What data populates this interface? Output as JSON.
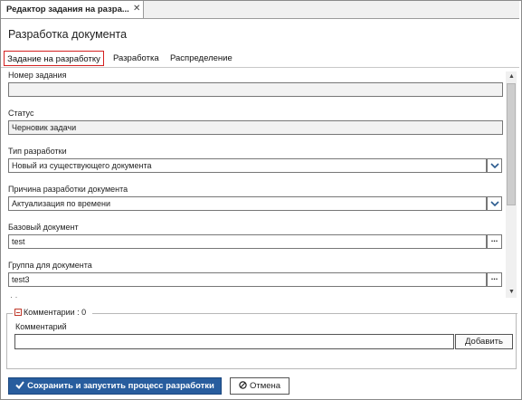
{
  "document_tab": {
    "title": "Редактор задания на разра...",
    "close_icon": "close-icon"
  },
  "page_title": "Разработка документа",
  "subtabs": [
    {
      "label": "Задание на разработку",
      "active": true
    },
    {
      "label": "Разработка",
      "active": false
    },
    {
      "label": "Распределение",
      "active": false
    }
  ],
  "fields": {
    "task_number": {
      "label": "Номер задания",
      "value": ""
    },
    "status": {
      "label": "Статус",
      "value": "Черновик задачи"
    },
    "dev_type": {
      "label": "Тип разработки",
      "value": "Новый из существующего документа"
    },
    "reason": {
      "label": "Причина разработки документа",
      "value": "Актуализация по времени"
    },
    "base_doc": {
      "label": "Базовый документ",
      "value": "test",
      "lookup_label": "..."
    },
    "group": {
      "label": "Группа для документа",
      "value": "test3",
      "lookup_label": "..."
    }
  },
  "comments": {
    "legend": "Комментарии : 0",
    "label": "Комментарий",
    "input_value": "",
    "add_label": "Добавить"
  },
  "actions": {
    "save_label": "Сохранить и запустить процесс разработки",
    "cancel_label": "Отмена"
  },
  "colors": {
    "primary": "#285d9e",
    "active_tab_border": "#d42020"
  }
}
